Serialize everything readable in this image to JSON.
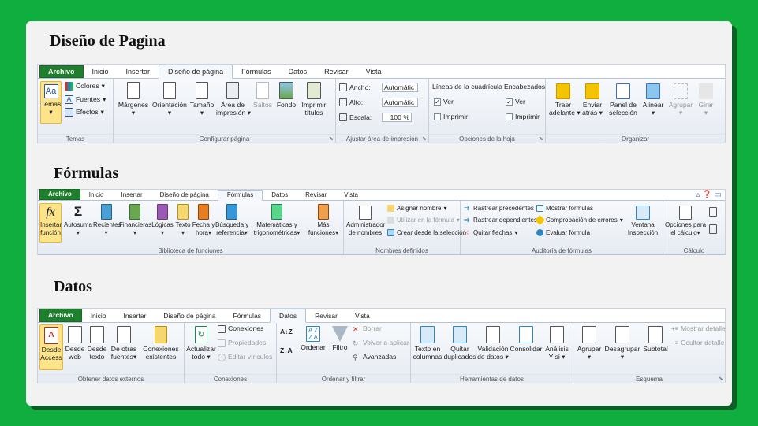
{
  "sections": {
    "diseno": {
      "title": "Diseño de Pagina",
      "tabs": [
        "Archivo",
        "Inicio",
        "Insertar",
        "Diseño de página",
        "Fórmulas",
        "Datos",
        "Revisar",
        "Vista"
      ],
      "groups": {
        "temas": "Temas",
        "configurar": "Configurar página",
        "ajustar": "Ajustar área de impresión",
        "opciones": "Opciones de la hoja",
        "organizar": "Organizar"
      },
      "buttons": {
        "temas": "Temas",
        "colores": "Colores",
        "fuentes": "Fuentes",
        "efectos": "Efectos",
        "margenes": "Márgenes",
        "orientacion": "Orientación",
        "tamano": "Tamaño",
        "area1": "Área de",
        "area2": "impresión",
        "saltos": "Saltos",
        "fondo": "Fondo",
        "imprimir1": "Imprimir",
        "imprimir2": "títulos",
        "ancho": "Ancho:",
        "ancho_val": "Automátic",
        "alto": "Alto:",
        "alto_val": "Automátic",
        "escala": "Escala:",
        "escala_val": "100 %",
        "lineas": "Líneas de la cuadrícula",
        "encabezados": "Encabezados",
        "ver": "Ver",
        "imprimir": "Imprimir",
        "traer1": "Traer",
        "traer2": "adelante",
        "enviar1": "Enviar",
        "enviar2": "atrás",
        "panel1": "Panel de",
        "panel2": "selección",
        "alinear": "Alinear",
        "agrupar": "Agrupar",
        "girar": "Girar"
      }
    },
    "formulas": {
      "title": "Fórmulas",
      "tabs": [
        "Archivo",
        "Inicio",
        "Insertar",
        "Diseño de página",
        "Fórmulas",
        "Datos",
        "Revisar",
        "Vista"
      ],
      "groups": {
        "biblioteca": "Biblioteca de funciones",
        "nombres": "Nombres definidos",
        "auditoria": "Auditoría de fórmulas",
        "calculo": "Cálculo"
      },
      "buttons": {
        "insertar1": "Insertar",
        "insertar2": "función",
        "autosuma": "Autosuma",
        "recientes": "Recientes",
        "financieras": "Financieras",
        "logicas": "Lógicas",
        "texto": "Texto",
        "fecha1": "Fecha y",
        "fecha2": "hora",
        "busqueda1": "Búsqueda y",
        "busqueda2": "referencia",
        "mate1": "Matemáticas y",
        "mate2": "trigonométricas",
        "mas1": "Más",
        "mas2": "funciones",
        "admin1": "Administrador",
        "admin2": "de nombres",
        "asignar": "Asignar nombre",
        "utilizar": "Utilizar en la fórmula",
        "crear": "Crear desde la selección",
        "rprec": "Rastrear precedentes",
        "rdep": "Rastrear dependientes",
        "quitar": "Quitar flechas",
        "mostrar": "Mostrar fórmulas",
        "comprob": "Comprobación de errores",
        "evaluar": "Evaluar fórmula",
        "ventana1": "Ventana",
        "ventana2": "Inspección",
        "opciones1": "Opciones para",
        "opciones2": "el cálculo"
      }
    },
    "datos": {
      "title": "Datos",
      "tabs": [
        "Archivo",
        "Inicio",
        "Insertar",
        "Diseño de página",
        "Fórmulas",
        "Datos",
        "Revisar",
        "Vista"
      ],
      "groups": {
        "externos": "Obtener datos externos",
        "conexiones": "Conexiones",
        "ordenar": "Ordenar y filtrar",
        "herramientas": "Herramientas de datos",
        "esquema": "Esquema"
      },
      "buttons": {
        "access1": "Desde",
        "access2": "Access",
        "web1": "Desde",
        "web2": "web",
        "texto1": "Desde",
        "texto2": "texto",
        "otras1": "De otras",
        "otras2": "fuentes",
        "conex1": "Conexiones",
        "conex2": "existentes",
        "actualizar1": "Actualizar",
        "actualizar2": "todo",
        "conexiones": "Conexiones",
        "propiedades": "Propiedades",
        "editar": "Editar vínculos",
        "ordenar": "Ordenar",
        "filtro": "Filtro",
        "borrar": "Borrar",
        "volver": "Volver a aplicar",
        "avanzadas": "Avanzadas",
        "tcol1": "Texto en",
        "tcol2": "columnas",
        "quitar1": "Quitar",
        "quitar2": "duplicados",
        "valid1": "Validación",
        "valid2": "de datos",
        "consolidar": "Consolidar",
        "analisis1": "Análisis",
        "analisis2": "Y si",
        "agrupar": "Agrupar",
        "desagrupar": "Desagrupar",
        "subtotal": "Subtotal",
        "mostrar": "Mostrar detalle",
        "ocultar": "Ocultar detalle"
      }
    }
  }
}
